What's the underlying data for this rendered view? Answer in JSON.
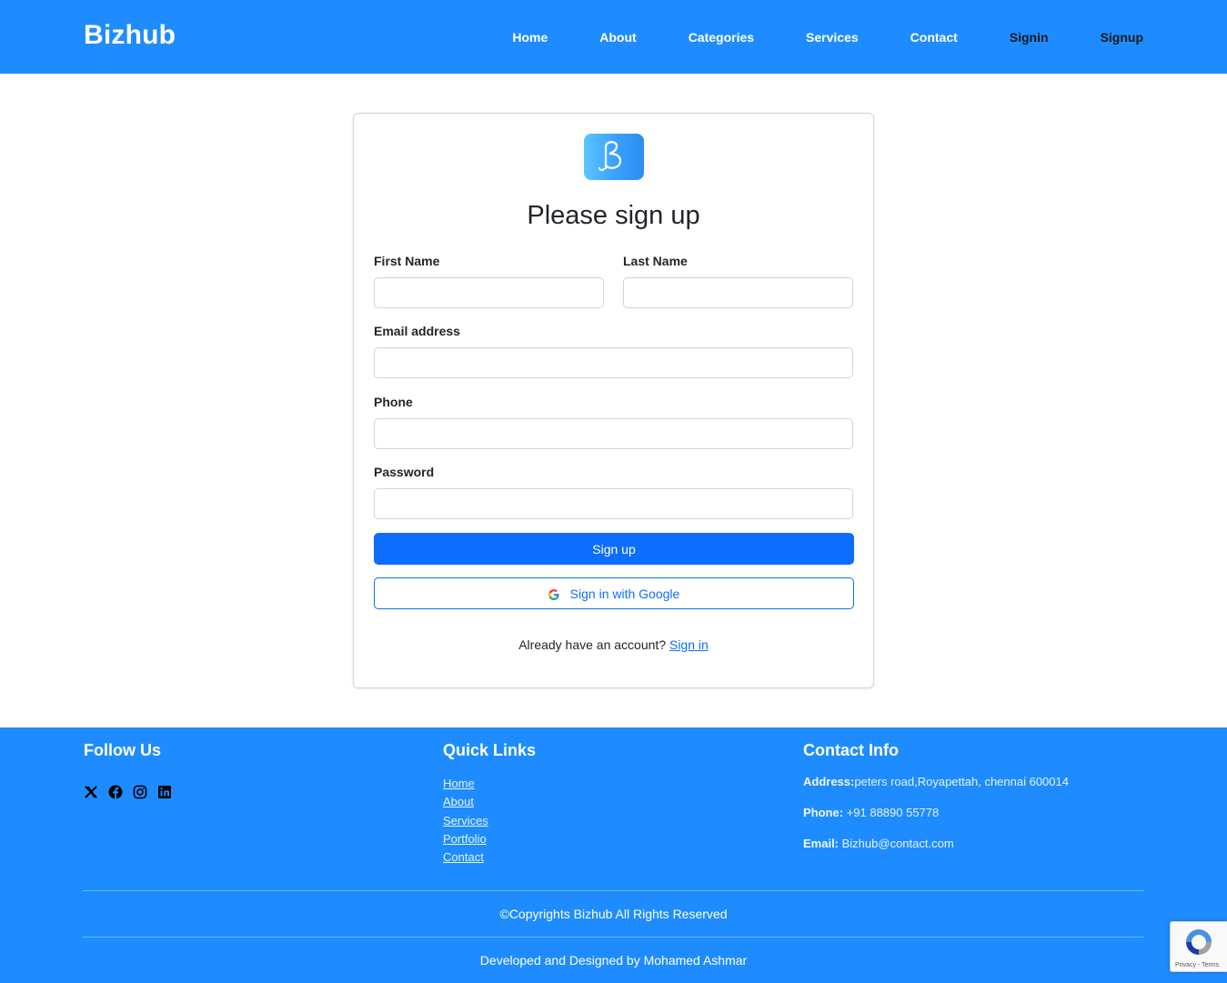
{
  "header": {
    "brand": "Bizhub",
    "nav": {
      "home": "Home",
      "about": "About",
      "categories": "Categories",
      "services": "Services",
      "contact": "Contact",
      "signin": "Signin",
      "signup": "Signup"
    }
  },
  "form": {
    "title": "Please sign up",
    "first_name_label": "First Name",
    "last_name_label": "Last Name",
    "email_label": "Email address",
    "phone_label": "Phone",
    "password_label": "Password",
    "first_name_value": "",
    "last_name_value": "",
    "email_value": "",
    "phone_value": "",
    "password_value": "",
    "signup_button": "Sign up",
    "google_button": "Sign in with Google",
    "already_text": "Already have an account? ",
    "signin_link": "Sign in"
  },
  "footer": {
    "follow_title": "Follow Us",
    "quick_title": "Quick Links",
    "contact_title": "Contact Info",
    "social_icons": [
      "x-icon",
      "facebook-icon",
      "instagram-icon",
      "linkedin-icon"
    ],
    "quick_links": {
      "home": "Home",
      "about": "About",
      "services": "Services",
      "portfolio": "Portfolio",
      "contact": "Contact"
    },
    "contact": {
      "address_label": "Address:",
      "address_value": "peters road,Royapettah, chennai 600014",
      "phone_label": "Phone:",
      "phone_value": " +91 88890 55778",
      "email_label": "Email:",
      "email_value": " Bizhub@contact.com"
    },
    "copyright": "©Copyrights Bizhub All Rights Reserved",
    "developer": "Developed and Designed by Mohamed Ashmar"
  },
  "recaptcha": {
    "text": "Privacy - Terms"
  },
  "colors": {
    "brand_blue": "#1e8cff",
    "primary_button": "#0d6efd"
  }
}
